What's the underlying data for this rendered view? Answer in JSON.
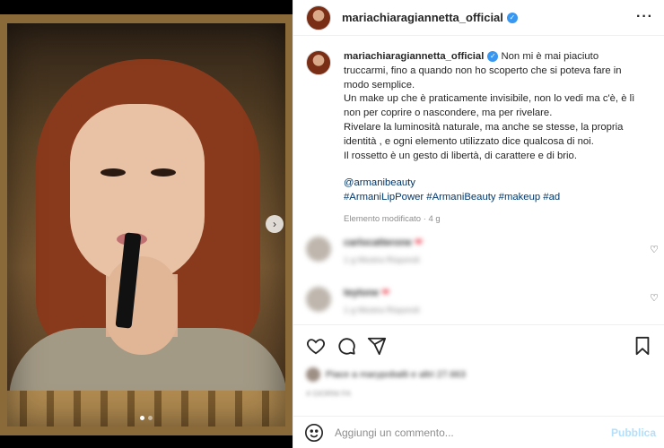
{
  "post": {
    "author": {
      "username": "mariachiaragiannetta_official",
      "verified_icon": "verified-badge-icon"
    },
    "media": {
      "slide_count": 2,
      "active_slide": 1,
      "next_icon": "chevron-right-icon"
    },
    "caption": {
      "username": "mariachiaragiannetta_official",
      "lines": [
        "Non mi è mai piaciuto truccarmi, fino a quando non ho scoperto che si poteva fare in modo semplice.",
        "Un make up che è praticamente invisibile, non lo vedi ma c'è, è lì non per coprire o nascondere, ma per rivelare.",
        "Rivelare la luminosità naturale, ma anche se stesse, la propria identità , e ogni elemento utilizzato dice qualcosa di noi.",
        "Il rossetto è un gesto di libertà, di carattere e di brio."
      ],
      "mention": "@armanibeauty",
      "hashtags": "#ArmaniLipPower #ArmaniBeauty #makeup #ad",
      "meta": "Elemento modificato · 4 g"
    },
    "comments": [
      {
        "name": "carlocatterone",
        "reply": "1 g   Mostra   Rispondi"
      },
      {
        "name": "teytone",
        "reply": "1 g   Mostra   Rispondi"
      }
    ],
    "likes_text": "Piace a marypobalti e altri 27.663",
    "likes_date": "4 GIORNI FA",
    "add_comment": {
      "placeholder": "Aggiungi un commento...",
      "publish_label": "Pubblica"
    },
    "colors": {
      "verified": "#3897f0",
      "link": "#00376b",
      "publish_disabled": "#b2dffc"
    }
  }
}
